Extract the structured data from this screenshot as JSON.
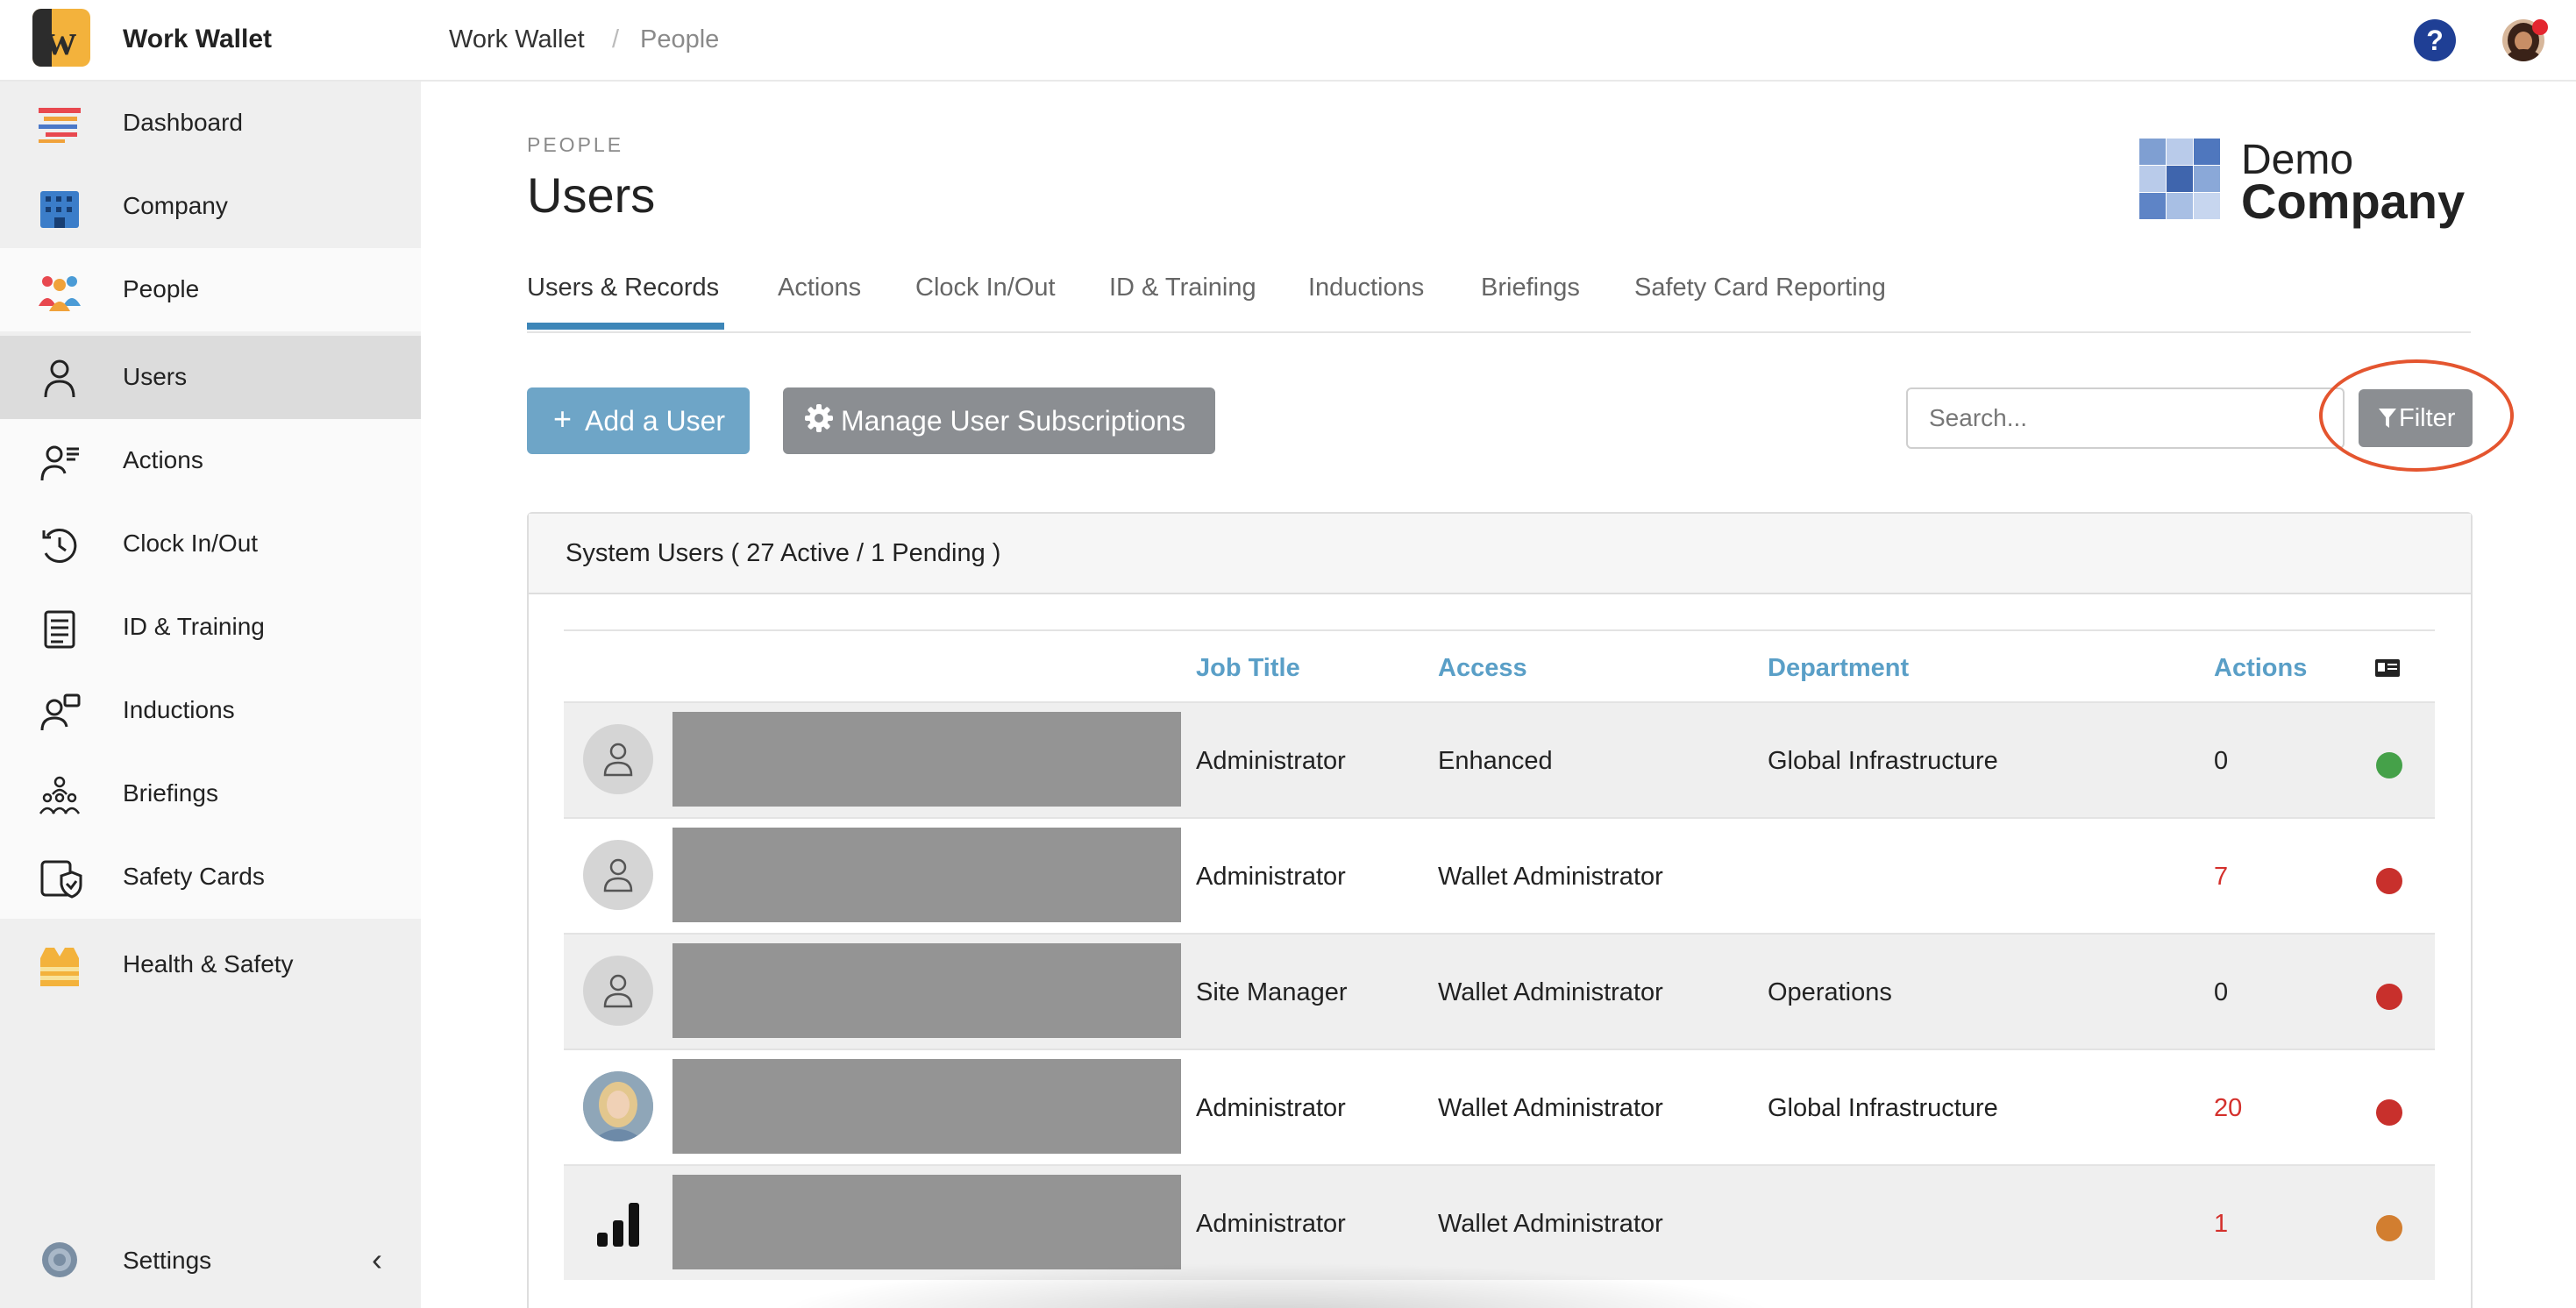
{
  "app": {
    "brand": "Work Wallet",
    "logo_letter": "w"
  },
  "breadcrumb": {
    "root": "Work Wallet",
    "separator": "/",
    "current": "People"
  },
  "topbar": {
    "help_symbol": "?"
  },
  "sidebar": {
    "items": [
      {
        "label": "Dashboard",
        "icon": "dashboard-icon"
      },
      {
        "label": "Company",
        "icon": "building-icon"
      },
      {
        "label": "People",
        "icon": "people-group-icon"
      },
      {
        "label": "Users",
        "icon": "user-icon"
      },
      {
        "label": "Actions",
        "icon": "user-list-icon"
      },
      {
        "label": "Clock In/Out",
        "icon": "clock-icon"
      },
      {
        "label": "ID & Training",
        "icon": "id-card-icon"
      },
      {
        "label": "Inductions",
        "icon": "user-chat-icon"
      },
      {
        "label": "Briefings",
        "icon": "group-meeting-icon"
      },
      {
        "label": "Safety Cards",
        "icon": "shield-card-icon"
      },
      {
        "label": "Health & Safety",
        "icon": "safety-vest-icon"
      }
    ],
    "settings_label": "Settings",
    "collapse_symbol": "‹"
  },
  "page": {
    "section": "PEOPLE",
    "title": "Users",
    "company_logo": {
      "line1": "Demo",
      "line2": "Company"
    }
  },
  "tabs": [
    {
      "label": "Users & Records",
      "active": true
    },
    {
      "label": "Actions"
    },
    {
      "label": "Clock In/Out"
    },
    {
      "label": "ID & Training"
    },
    {
      "label": "Inductions"
    },
    {
      "label": "Briefings"
    },
    {
      "label": "Safety Card Reporting"
    }
  ],
  "toolbar": {
    "add_user_plus": "+",
    "add_user_label": "Add a User",
    "manage_label": "Manage User Subscriptions",
    "search_placeholder": "Search...",
    "filter_label": "Filter"
  },
  "panel": {
    "heading": "System Users ( 27 Active / 1 Pending )"
  },
  "table": {
    "headers": {
      "job_title": "Job Title",
      "access": "Access",
      "department": "Department",
      "actions": "Actions"
    },
    "rows": [
      {
        "job_title": "Administrator",
        "access": "Enhanced",
        "department": "Global Infrastructure",
        "actions": "0",
        "status_color": "#45a149"
      },
      {
        "job_title": "Administrator",
        "access": "Wallet Administrator",
        "department": "",
        "actions": "7",
        "status_color": "#c8302c"
      },
      {
        "job_title": "Site Manager",
        "access": "Wallet Administrator",
        "department": "Operations",
        "actions": "0",
        "status_color": "#c8302c"
      },
      {
        "job_title": "Administrator",
        "access": "Wallet Administrator",
        "department": "Global Infrastructure",
        "actions": "20",
        "status_color": "#c8302c"
      },
      {
        "job_title": "Administrator",
        "access": "Wallet Administrator",
        "department": "",
        "actions": "1",
        "status_color": "#d27e30"
      }
    ]
  },
  "colors": {
    "accent": "#3d86b8",
    "header_text": "#5a9fc7",
    "alert": "#d4302c"
  }
}
